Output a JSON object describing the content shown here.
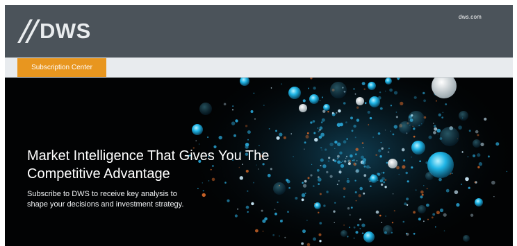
{
  "brand": {
    "logo_text": "DWS",
    "site_link": "dws.com"
  },
  "tabs": [
    {
      "label": "Subscription Center",
      "active": true
    }
  ],
  "hero": {
    "title": "Market Intelligence That Gives You The\nCompetitive Advantage",
    "subtitle": "Subscribe to DWS to receive key analysis to\nshape your decisions and investment strategy."
  },
  "colors": {
    "header_bg": "#4b535a",
    "tab_active": "#e8961f",
    "hero_bg": "#020304",
    "bubble_accent": "#1fb5e6"
  }
}
